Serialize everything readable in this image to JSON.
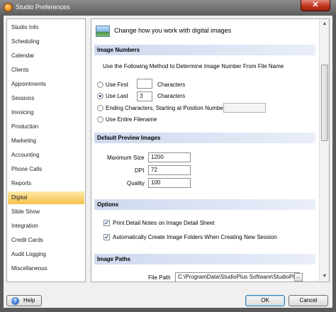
{
  "window": {
    "title": "Studio Preferences",
    "close_glyph": "✕"
  },
  "sidebar": {
    "items": [
      {
        "label": "Studio Info"
      },
      {
        "label": "Scheduling"
      },
      {
        "label": "Calendar"
      },
      {
        "label": "Clients"
      },
      {
        "label": "Appointments"
      },
      {
        "label": "Sessions"
      },
      {
        "label": "Invoicing"
      },
      {
        "label": "Production"
      },
      {
        "label": "Marketing"
      },
      {
        "label": "Accounting"
      },
      {
        "label": "Phone Calls"
      },
      {
        "label": "Reports"
      },
      {
        "label": "Digital",
        "selected": true
      },
      {
        "label": "Slide Show"
      },
      {
        "label": "Integration"
      },
      {
        "label": "Credit Cards"
      },
      {
        "label": "Audit Logging"
      },
      {
        "label": "Miscellaneous"
      }
    ]
  },
  "content": {
    "banner_text": "Change how you work with digital images",
    "image_numbers": {
      "header": "Image Numbers",
      "instruction": "Use the Following Method to Determine Image Number From File Name",
      "use_first_label": "Use First",
      "use_first_value": "",
      "use_first_suffix": "Characters",
      "use_last_label": "Use Last",
      "use_last_value": "3",
      "use_last_suffix": "Characters",
      "ending_chars_label": "Ending Characters, Starting at Position Number",
      "ending_chars_value": "",
      "entire_filename_label": "Use Entire Filename",
      "selected_method": "Use Last"
    },
    "default_preview": {
      "header": "Default Preview Images",
      "max_size_label": "Maximum Size",
      "max_size_value": "1200",
      "dpi_label": "DPI",
      "dpi_value": "72",
      "quality_label": "Quality",
      "quality_value": "100"
    },
    "options": {
      "header": "Options",
      "print_notes_label": "Print Detail Notes on Image Detail Sheet",
      "print_notes_checked": true,
      "auto_create_label": "Automatically Create Image Folders When Creating New Session",
      "auto_create_checked": true
    },
    "image_paths": {
      "header": "Image Paths",
      "file_path_label": "File Path",
      "file_path_value": "C:\\ProgramData\\StudioPlus Software\\StudioPlu",
      "browse_label": "..."
    }
  },
  "footer": {
    "help_label": "Help",
    "ok_label": "OK",
    "cancel_label": "Cancel"
  },
  "icons": {
    "app": "studio-app-icon",
    "banner": "digital-image-icon",
    "help": "help-icon",
    "check": "✓"
  }
}
